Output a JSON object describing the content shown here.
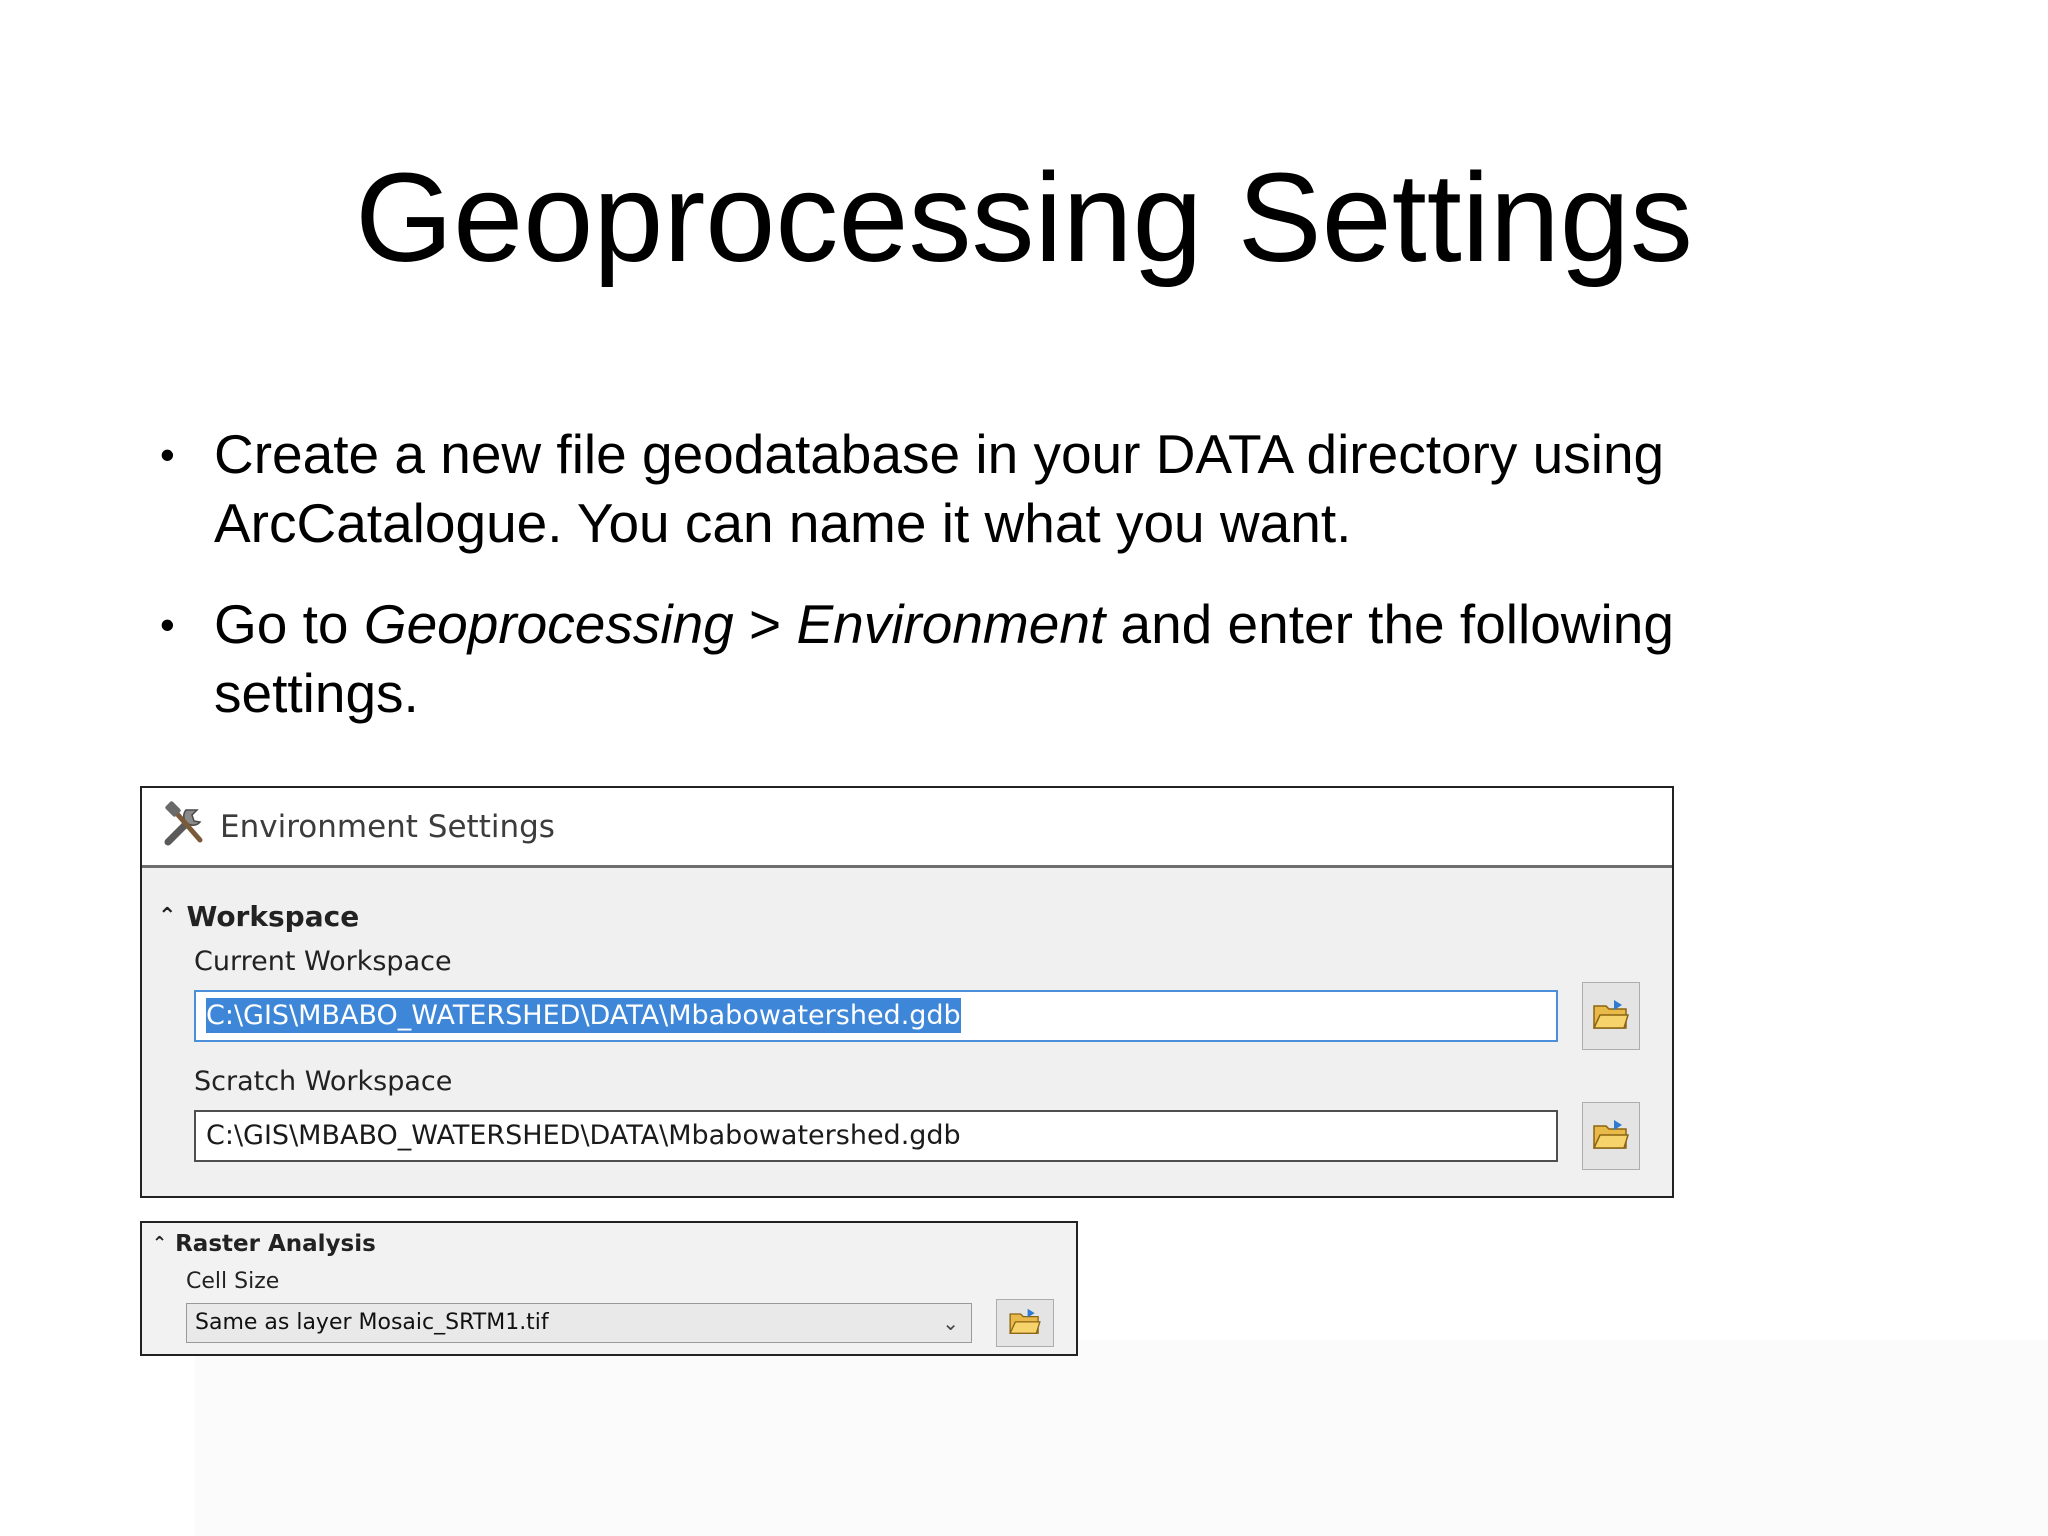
{
  "slide": {
    "title": "Geoprocessing Settings",
    "bullets": [
      {
        "text": "Create a new file geodatabase in your DATA directory using ArcCatalogue. You can name it what you want."
      },
      {
        "prefix": "Go to ",
        "menu_1": "Geoprocessing",
        "sep": " > ",
        "menu_2": "Environment",
        "suffix": " and enter the following settings."
      }
    ]
  },
  "environment_settings": {
    "title": "Environment Settings",
    "icon": "tools-icon",
    "section": "Workspace",
    "current_workspace": {
      "label": "Current Workspace",
      "value": "C:\\GIS\\MBABO_WATERSHED\\DATA\\Mbabowatershed.gdb",
      "selected": true
    },
    "scratch_workspace": {
      "label": "Scratch Workspace",
      "value": "C:\\GIS\\MBABO_WATERSHED\\DATA\\Mbabowatershed.gdb"
    },
    "browse_icon": "open-folder-icon"
  },
  "raster_analysis": {
    "section": "Raster Analysis",
    "cell_size": {
      "label": "Cell Size",
      "value": "Same as layer Mosaic_SRTM1.tif"
    }
  },
  "colors": {
    "selection": "#3d86d8",
    "focus_border": "#4a8fd8",
    "panel_bg": "#f0f0f0"
  }
}
